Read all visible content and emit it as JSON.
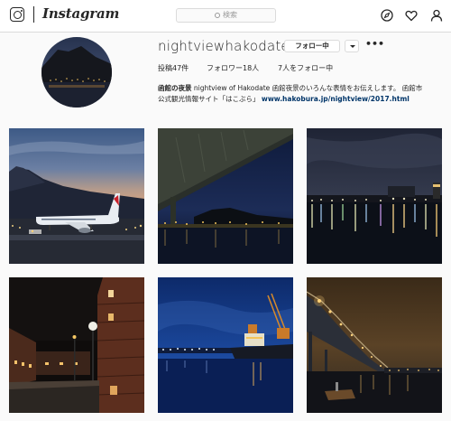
{
  "topbar": {
    "brand": "Instagram",
    "search_placeholder": "検索"
  },
  "profile": {
    "username": "nightviewhakodate",
    "follow_label": "フォロー中",
    "more_label": "•••",
    "stats": {
      "posts": "投稿47件",
      "followers": "フォロワー18人",
      "following": "7人をフォロー中"
    },
    "bio_name": "函館の夜景",
    "bio_text": " nightview of Hakodate 函館夜景のいろんな表情をお伝えします。 函館市公式観光情報サイト「はこぶら」 ",
    "bio_link": "www.hakobura.jp/nightview/2017.html"
  },
  "posts": [
    {
      "subject": "airplane-at-dusk"
    },
    {
      "subject": "bridge-underside-night"
    },
    {
      "subject": "harbor-lights-night"
    },
    {
      "subject": "brick-warehouses-night"
    },
    {
      "subject": "port-cranes-ship-night"
    },
    {
      "subject": "bridge-lights-harbor-night"
    }
  ],
  "colors": {
    "border": "#dbdbdb",
    "link": "#003569",
    "text": "#262626"
  }
}
